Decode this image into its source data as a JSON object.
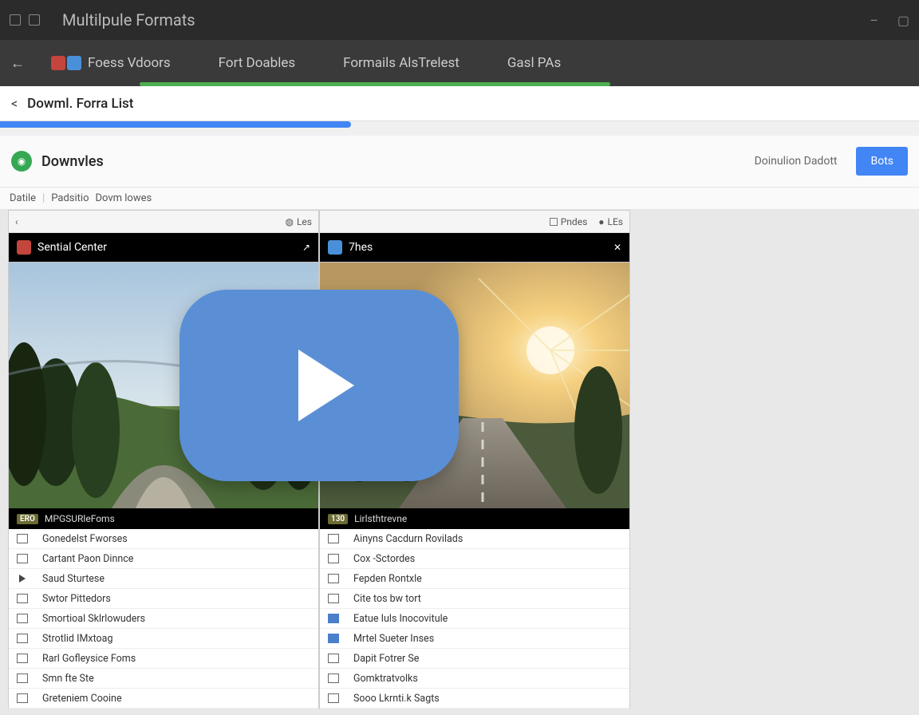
{
  "window": {
    "title": "Multilpule Formats",
    "minimize": "–",
    "maximize": "▢"
  },
  "tabs": {
    "items": [
      {
        "label": "Foess Vdoors"
      },
      {
        "label": "Fort Doables"
      },
      {
        "label": "Formails AlsTrelest"
      },
      {
        "label": "Gasl PAs"
      }
    ]
  },
  "subheader": {
    "back": "<",
    "title": "Dowml. Forra List"
  },
  "section": {
    "icon": "◉",
    "title": "Downvles",
    "link": "Doinulion Dadott",
    "button": "Bots"
  },
  "breadcrumb": {
    "items": [
      "Datile",
      "Padsitio",
      "Dovm lowes"
    ]
  },
  "panelLeft": {
    "toolbar": {
      "back": "‹",
      "item1_icon": "◍",
      "item1": "Les"
    },
    "title": "Sential Center",
    "title_action": "↗",
    "caption_badge": "ERO",
    "caption_text": "MPGSURleFoms",
    "rows": [
      "Gonedelst Fworses",
      "Cartant Paon Dinnce",
      "Saud Sturtese",
      "Swtor Pittedors",
      "Smortioal Sklrlowuders",
      "Strotlid IMxtoag",
      "Rarl Gofleysice Foms",
      "Smn fte Ste",
      "Greteniem Cooine"
    ]
  },
  "panelRight": {
    "toolbar": {
      "item1": "Pndes",
      "item2_icon": "●",
      "item2": "LEs"
    },
    "title": "7hes",
    "title_action": "✕",
    "caption_badge": "130",
    "caption_text": "Lirlsthtrevne",
    "rows": [
      "Ainyns Cacdurn Rovilads",
      "Cox -Sctordes",
      "Fepden Rontxle",
      "Cite tos bw tort",
      "Eatue Iuls Inocovitule",
      "Mrtel Sueter Inses",
      "Dapit Fotrer Se",
      "Gomktratvolks",
      "Sooo Lkrnti.k Sagts"
    ]
  }
}
